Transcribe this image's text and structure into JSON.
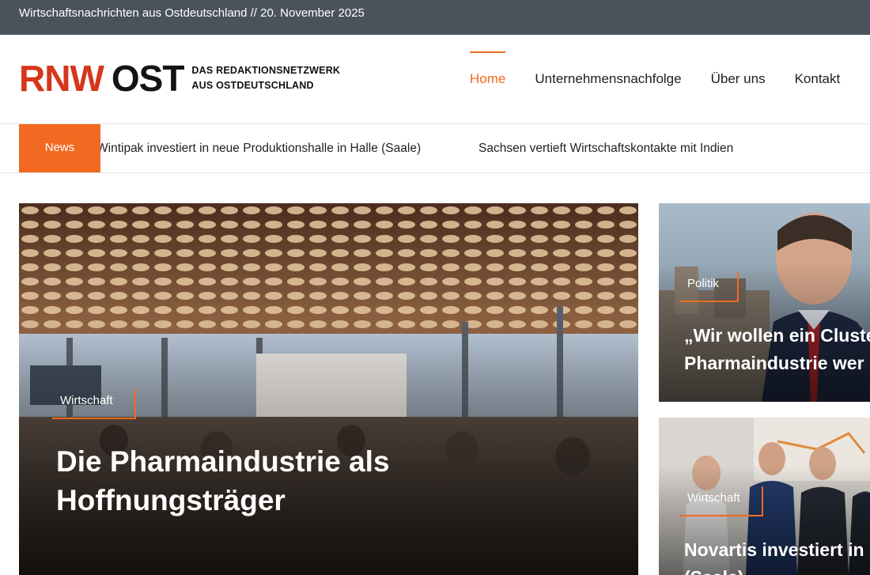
{
  "topbar": {
    "date_line": "Wirtschaftsnachrichten aus Ostdeutschland // 20. November 2025"
  },
  "logo": {
    "rnw": "RNW",
    "ost": "OST",
    "tagline_line1": "DAS REDAKTIONSNETZWERK",
    "tagline_line2": "AUS OSTDEUTSCHLAND"
  },
  "nav": {
    "items": [
      {
        "label": "Home",
        "active": true
      },
      {
        "label": "Unternehmensnachfolge",
        "active": false
      },
      {
        "label": "Über uns",
        "active": false
      },
      {
        "label": "Kontakt",
        "active": false
      }
    ]
  },
  "ticker": {
    "tag": "News",
    "items": [
      "Wintipak investiert in neue Produktionshalle in Halle (Saale)",
      "Sachsen vertieft Wirtschaftskontakte mit Indien"
    ]
  },
  "featured": {
    "category": "Wirtschaft",
    "headline_line1": "Die Pharmaindustrie als",
    "headline_line2": "Hoffnungsträger"
  },
  "side_articles": [
    {
      "category": "Politik",
      "headline_line1": "„Wir wollen ein Cluste",
      "headline_line2": "Pharmaindustrie wer"
    },
    {
      "category": "Wirtschaft",
      "headline_line1": "Novartis investiert in",
      "headline_line2": "(Saale)"
    }
  ],
  "colors": {
    "accent": "#f26a21",
    "topbar_bg": "#4a535c",
    "logo_red": "#d6361b"
  }
}
